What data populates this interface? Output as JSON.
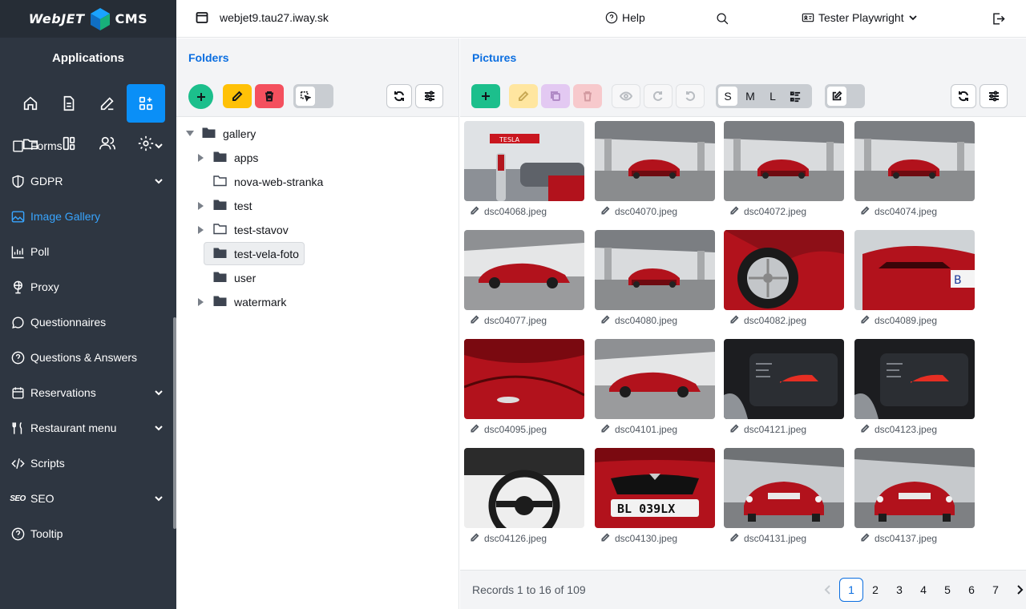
{
  "brand": {
    "left": "WebJET",
    "right": "CMS"
  },
  "sidebar": {
    "title": "Applications",
    "app_icons": [
      "home-icon",
      "document-icon",
      "edit-icon",
      "apps-icon",
      "folder-icon",
      "layout-icon",
      "users-icon",
      "settings-icon"
    ],
    "items": [
      {
        "label": "Forms",
        "icon": "forms-icon",
        "chevron": true
      },
      {
        "label": "GDPR",
        "icon": "shield-icon",
        "chevron": true
      },
      {
        "label": "Image Gallery",
        "icon": "image-icon",
        "active": true
      },
      {
        "label": "Poll",
        "icon": "chart-icon"
      },
      {
        "label": "Proxy",
        "icon": "globe-icon"
      },
      {
        "label": "Questionnaires",
        "icon": "chat-icon"
      },
      {
        "label": "Questions & Answers",
        "icon": "question-icon"
      },
      {
        "label": "Reservations",
        "icon": "calendar-icon",
        "chevron": true
      },
      {
        "label": "Restaurant menu",
        "icon": "cutlery-icon",
        "chevron": true
      },
      {
        "label": "Scripts",
        "icon": "code-icon"
      },
      {
        "label": "SEO",
        "icon": "seo-icon",
        "chevron": true
      },
      {
        "label": "Tooltip",
        "icon": "question-icon"
      }
    ]
  },
  "header": {
    "domain": "webjet9.tau27.iway.sk",
    "help": "Help",
    "user": "Tester Playwright"
  },
  "folders": {
    "title": "Folders",
    "tree": [
      {
        "label": "gallery",
        "level": 0,
        "expanded": true,
        "filled": true
      },
      {
        "label": "apps",
        "level": 1,
        "caret": true,
        "filled": true
      },
      {
        "label": "nova-web-stranka",
        "level": 1,
        "caret": false,
        "filled": false
      },
      {
        "label": "test",
        "level": 1,
        "caret": true,
        "filled": true
      },
      {
        "label": "test-stavov",
        "level": 1,
        "caret": true,
        "filled": false
      },
      {
        "label": "test-vela-foto",
        "level": 1,
        "caret": false,
        "filled": true,
        "selected": true
      },
      {
        "label": "user",
        "level": 1,
        "caret": false,
        "filled": true
      },
      {
        "label": "watermark",
        "level": 1,
        "caret": true,
        "filled": true
      }
    ]
  },
  "pictures": {
    "title": "Pictures",
    "sizes": [
      "S",
      "M",
      "L"
    ],
    "images": [
      {
        "name": "dsc04068.jpeg",
        "scene": "charger"
      },
      {
        "name": "dsc04070.jpeg",
        "scene": "bridge"
      },
      {
        "name": "dsc04072.jpeg",
        "scene": "bridge"
      },
      {
        "name": "dsc04074.jpeg",
        "scene": "bridge"
      },
      {
        "name": "dsc04077.jpeg",
        "scene": "side"
      },
      {
        "name": "dsc04080.jpeg",
        "scene": "bridge"
      },
      {
        "name": "dsc04082.jpeg",
        "scene": "wheel"
      },
      {
        "name": "dsc04089.jpeg",
        "scene": "rear"
      },
      {
        "name": "dsc04095.jpeg",
        "scene": "closeup"
      },
      {
        "name": "dsc04101.jpeg",
        "scene": "side"
      },
      {
        "name": "dsc04121.jpeg",
        "scene": "dash"
      },
      {
        "name": "dsc04123.jpeg",
        "scene": "dash"
      },
      {
        "name": "dsc04126.jpeg",
        "scene": "steering"
      },
      {
        "name": "dsc04130.jpeg",
        "scene": "front"
      },
      {
        "name": "dsc04131.jpeg",
        "scene": "frontfull"
      },
      {
        "name": "dsc04137.jpeg",
        "scene": "frontfull"
      }
    ],
    "records": "Records 1 to 16 of 109",
    "pages": [
      "1",
      "2",
      "3",
      "4",
      "5",
      "6",
      "7"
    ],
    "active_page": "1"
  },
  "colors": {
    "sidebar_bg": "#2e3641",
    "accent_blue": "#0a8ff7",
    "title_blue": "#0b6ee0",
    "green": "#1cbf8c",
    "yellow": "#ffc107",
    "red": "#f4505e",
    "tesla_red": "#b2121c"
  }
}
